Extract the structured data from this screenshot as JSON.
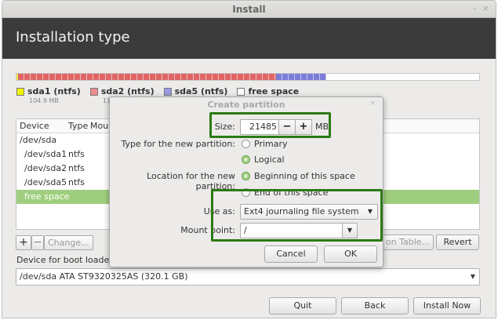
{
  "window": {
    "title": "Install",
    "controls": {
      "minimize": "–",
      "close": "×"
    }
  },
  "header": {
    "title": "Installation type"
  },
  "partition_bar": {
    "segments": [
      {
        "name": "sda1",
        "color": "#e8e84c",
        "fraction": 0.003
      },
      {
        "name": "sda2",
        "color": "#e06666",
        "fraction": 0.558
      },
      {
        "name": "sda5",
        "color": "#7c7cd8",
        "fraction": 0.108
      },
      {
        "name": "free space",
        "color": "#ffffff",
        "fraction": 0.331
      }
    ]
  },
  "legend": [
    {
      "label": "sda1 (ntfs)",
      "size": "104.9 MB",
      "color": "#f2f200"
    },
    {
      "label": "sda2 (ntfs)",
      "size": "110",
      "color": "#ee8c8c"
    },
    {
      "label": "sda5 (ntfs)",
      "size": "",
      "color": "#9c9ce6"
    },
    {
      "label": "free space",
      "size": "",
      "color": "#ffffff"
    }
  ],
  "table": {
    "headers": {
      "device": "Device",
      "type": "Type",
      "mount": "Mour"
    },
    "rows": [
      {
        "device": "/dev/sda",
        "type": ""
      },
      {
        "device": "/dev/sda1",
        "type": "ntfs"
      },
      {
        "device": "/dev/sda2",
        "type": "ntfs"
      },
      {
        "device": "/dev/sda5",
        "type": "ntfs"
      },
      {
        "device": "free space",
        "type": ""
      }
    ],
    "selected_row": 4
  },
  "toolbar": {
    "add": "+",
    "remove": "−",
    "change": "Change...",
    "new_table": "on Table...",
    "revert": "Revert"
  },
  "boot": {
    "label": "Device for boot loader in",
    "value": "/dev/sda   ATA ST9320325AS (320.1 GB)"
  },
  "dialog": {
    "title": "Create partition",
    "close": "×",
    "size": {
      "label": "Size:",
      "value": "21485",
      "minus": "−",
      "plus": "+",
      "unit": "MB"
    },
    "type": {
      "label": "Type for the new partition:",
      "options": [
        "Primary",
        "Logical"
      ],
      "selected": "Logical"
    },
    "location": {
      "label": "Location for the new partition:",
      "options": [
        "Beginning of this space",
        "End of this space"
      ],
      "selected": "Beginning of this space"
    },
    "use_as": {
      "label": "Use as:",
      "value": "Ext4 journaling file system"
    },
    "mount": {
      "label": "Mount point:",
      "value": "/"
    },
    "cancel": "Cancel",
    "ok": "OK"
  },
  "footer": {
    "quit": "Quit",
    "back": "Back",
    "install": "Install Now"
  },
  "highlight_color": "#2c7a15"
}
